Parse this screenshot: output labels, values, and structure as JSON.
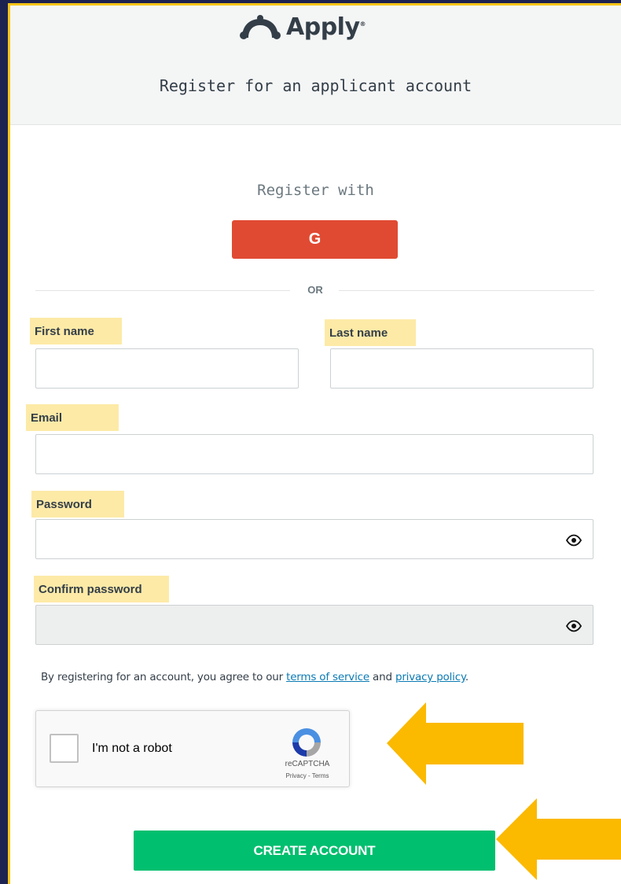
{
  "header": {
    "logo_text": "Apply",
    "logo_reg": "®",
    "subtitle": "Register for an applicant account"
  },
  "social": {
    "register_with": "Register with",
    "google_label": "G",
    "or_label": "OR"
  },
  "form": {
    "first_name_label": "First name",
    "first_name_value": "",
    "last_name_label": "Last name",
    "last_name_value": "",
    "email_label": "Email",
    "email_value": "",
    "password_label": "Password",
    "password_value": "",
    "confirm_password_label": "Confirm password",
    "confirm_password_value": ""
  },
  "legal": {
    "prefix": "By registering for an account, you agree to our ",
    "terms_link": "terms of service",
    "middle": " and ",
    "privacy_link": "privacy policy",
    "suffix": "."
  },
  "captcha": {
    "label": "I'm not a robot",
    "brand": "reCAPTCHA",
    "links": "Privacy - Terms"
  },
  "submit": {
    "label": "CREATE ACCOUNT"
  },
  "colors": {
    "frame": "#1d2350",
    "accent_yellow": "#f5c518",
    "label_highlight": "#fdeaa7",
    "google_red": "#e04a32",
    "create_green": "#00bf6f",
    "link_blue": "#0a7ab4",
    "arrow": "#fbb900"
  },
  "icons": {
    "logo": "surveymonkey-logo-icon",
    "eye": "eye-icon",
    "captcha": "recaptcha-icon",
    "arrow": "left-arrow-icon"
  }
}
